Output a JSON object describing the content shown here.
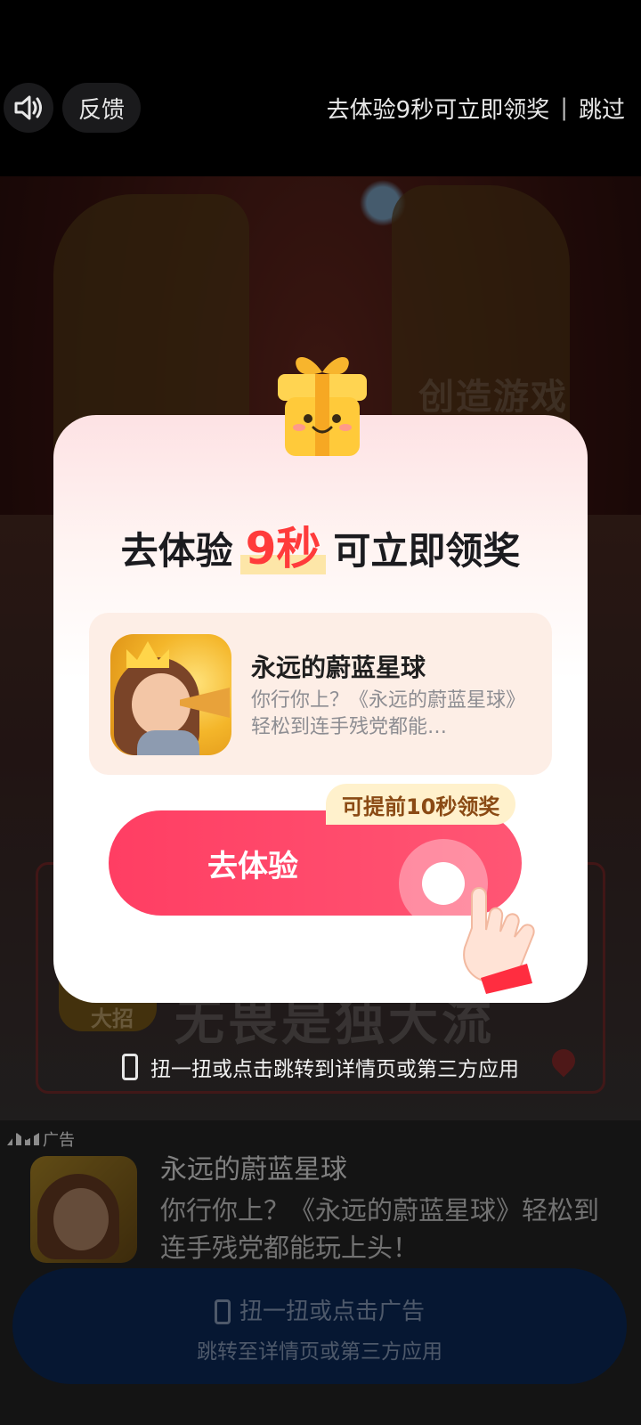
{
  "topbar": {
    "sound_icon": "speaker-icon",
    "feedback_label": "反馈",
    "skip_prompt": "去体验9秒可立即领奖",
    "separator": "|",
    "skip_label": "跳过"
  },
  "background": {
    "faint_title": "创造游戏",
    "side_label": "大招",
    "slogan": "无畏是独大流",
    "tilt_hint": "扭一扭或点击跳转到详情页或第三方应用"
  },
  "modal": {
    "title_prefix": "去体验",
    "title_number": "9秒",
    "title_suffix": "可立即领奖",
    "app_name": "永远的蔚蓝星球",
    "app_desc": "你行你上？《永远的蔚蓝星球》轻松到连手残党都能…",
    "early_badge": "可提前10秒领奖",
    "cta_label": "去体验"
  },
  "info_panel": {
    "ad_tag": "广告",
    "title": "永远的蔚蓝星球",
    "desc": "你行你上？《永远的蔚蓝星球》轻松到连手残党都能玩上头！",
    "cta_line1": "扭一扭或点击广告",
    "cta_line2": "跳转至详情页或第三方应用"
  },
  "colors": {
    "accent_red": "#ff3e63",
    "highlight_number": "#ff3b3b",
    "badge_bg": "#fff1cc",
    "cta_bar": "#0b2a5c"
  }
}
